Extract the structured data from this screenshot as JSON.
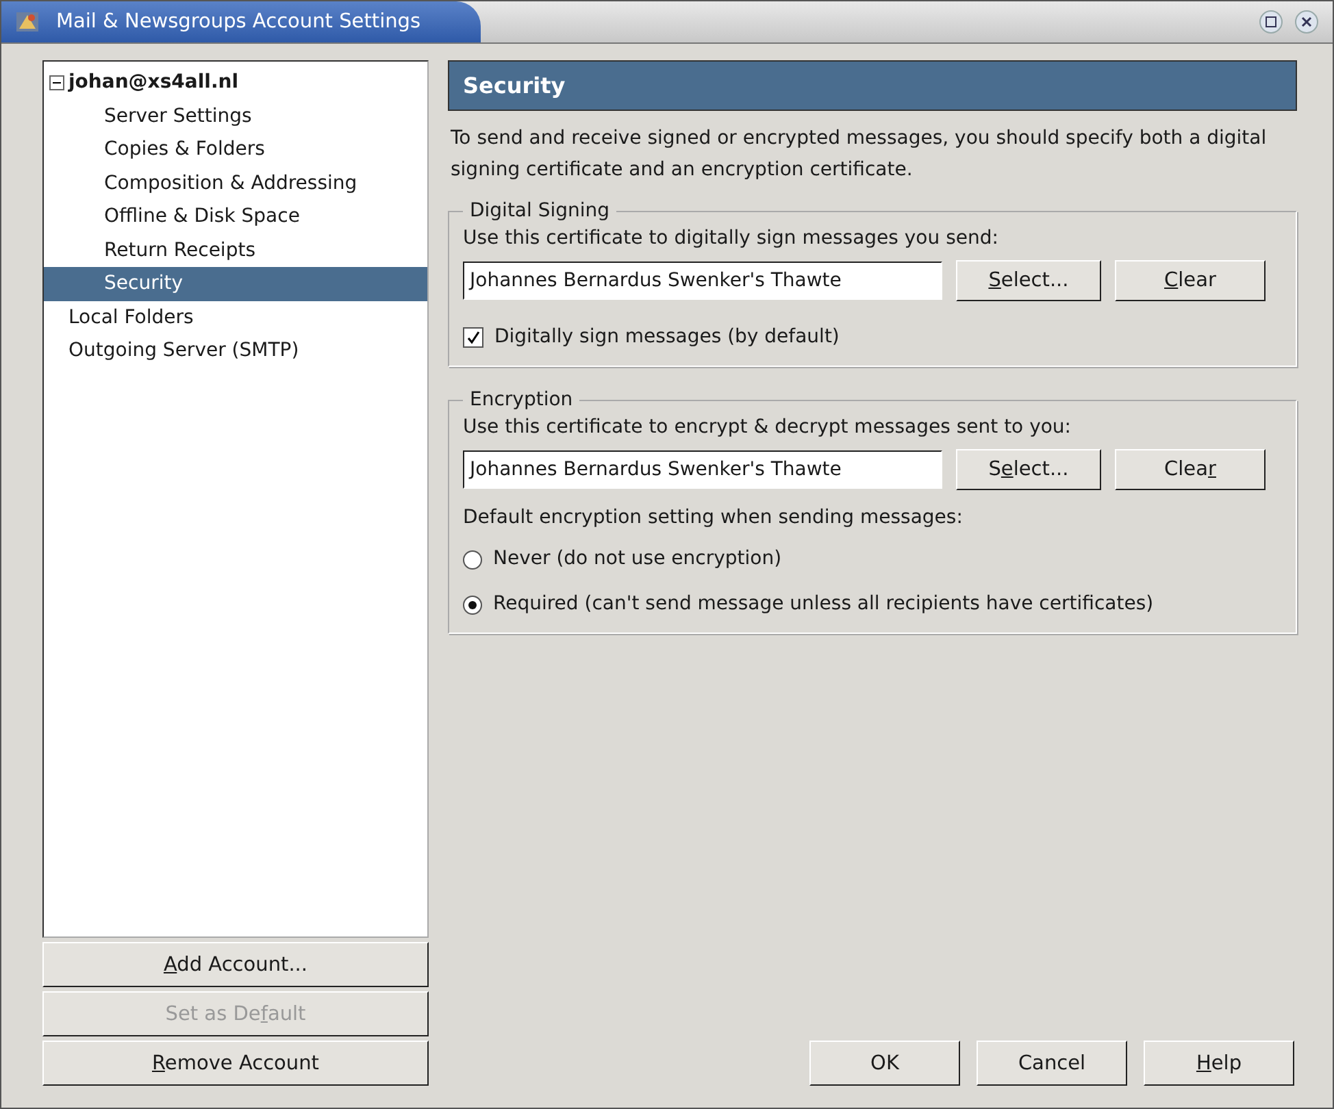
{
  "window": {
    "title": "Mail & Newsgroups Account Settings"
  },
  "sidebar": {
    "items": [
      {
        "label": "johan@xs4all.nl",
        "selected": false,
        "expanded": true,
        "children": [
          {
            "label": "Server Settings",
            "selected": false
          },
          {
            "label": "Copies & Folders",
            "selected": false
          },
          {
            "label": "Composition & Addressing",
            "selected": false
          },
          {
            "label": "Offline & Disk Space",
            "selected": false
          },
          {
            "label": "Return Receipts",
            "selected": false
          },
          {
            "label": "Security",
            "selected": true
          }
        ]
      },
      {
        "label": "Local Folders",
        "selected": false
      },
      {
        "label": "Outgoing Server (SMTP)",
        "selected": false
      }
    ],
    "buttons": [
      {
        "label": [
          {
            "text": "A",
            "underlined": true
          },
          {
            "text": "dd Account...",
            "underlined": false
          }
        ],
        "disabled": false
      },
      {
        "label": [
          {
            "text": "Set as De",
            "underlined": false
          },
          {
            "text": "f",
            "underlined": true
          },
          {
            "text": "ault",
            "underlined": false
          }
        ],
        "disabled": true
      },
      {
        "label": [
          {
            "text": "R",
            "underlined": true
          },
          {
            "text": "emove Account",
            "underlined": false
          }
        ],
        "disabled": false
      }
    ]
  },
  "panel": {
    "title": "Security",
    "intro": "To send and receive signed or encrypted messages, you should specify both a digital signing certificate and an encryption certificate.",
    "signing": {
      "legend": "Digital Signing",
      "label": "Use this certificate to digitally sign messages you send:",
      "value": "Johannes Bernardus Swenker's Thawte",
      "buttons": [
        {
          "label": [
            {
              "text": "S",
              "underlined": true
            },
            {
              "text": "elect...",
              "underlined": false
            }
          ]
        },
        {
          "label": [
            {
              "text": "C",
              "underlined": true
            },
            {
              "text": "lear",
              "underlined": false
            }
          ]
        }
      ],
      "checkbox": {
        "label": "Digitally sign messages (by default)",
        "checked": true
      }
    },
    "encryption": {
      "legend": "Encryption",
      "label": "Use this certificate to encrypt & decrypt messages sent to you:",
      "value": "Johannes Bernardus Swenker's Thawte",
      "buttons": [
        {
          "label": [
            {
              "text": "S",
              "underlined": false
            },
            {
              "text": "e",
              "underlined": true
            },
            {
              "text": "lect...",
              "underlined": false
            }
          ]
        },
        {
          "label": [
            {
              "text": "Clea",
              "underlined": false
            },
            {
              "text": "r",
              "underlined": true
            }
          ]
        }
      ],
      "radio_label": "Default encryption setting when sending messages:",
      "options": [
        {
          "label": "Never (do not use encryption)",
          "selected": false
        },
        {
          "label": "Required (can't send message unless all recipients have certificates)",
          "selected": true
        }
      ]
    }
  },
  "footer": {
    "buttons": [
      {
        "label": [
          {
            "text": "OK",
            "underlined": false
          }
        ]
      },
      {
        "label": [
          {
            "text": "Cancel",
            "underlined": false
          }
        ]
      },
      {
        "label": [
          {
            "text": "H",
            "underlined": true
          },
          {
            "text": "elp",
            "underlined": false
          }
        ]
      }
    ]
  }
}
